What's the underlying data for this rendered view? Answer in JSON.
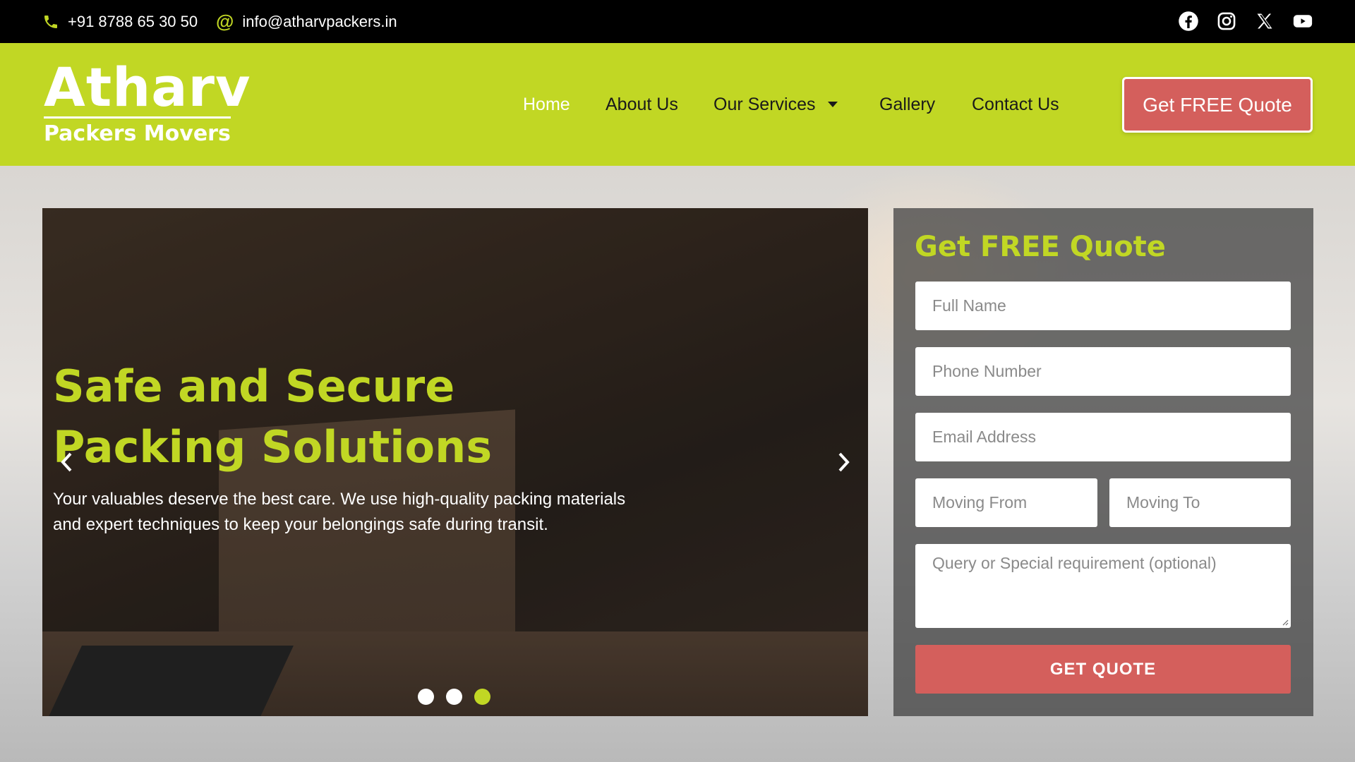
{
  "topbar": {
    "phone": "+91 8788 65 30 50",
    "email": "info@atharvpackers.in",
    "socials": [
      "facebook-icon",
      "instagram-icon",
      "x-icon",
      "youtube-icon"
    ]
  },
  "header": {
    "logo_main": "Atharv",
    "logo_sub": "Packers Movers",
    "nav": [
      {
        "label": "Home",
        "active": true
      },
      {
        "label": "About Us"
      },
      {
        "label": "Our Services",
        "has_dropdown": true
      },
      {
        "label": "Gallery"
      },
      {
        "label": "Contact Us"
      }
    ],
    "cta": "Get FREE Quote"
  },
  "hero": {
    "title_line1": "Safe and Secure",
    "title_line2": "Packing Solutions",
    "description": "Your valuables deserve the best care. We use high-quality packing materials and expert techniques to keep your belongings safe during transit.",
    "slides_count": 3,
    "active_slide": 3
  },
  "form": {
    "title": "Get FREE Quote",
    "full_name_placeholder": "Full Name",
    "phone_placeholder": "Phone Number",
    "email_placeholder": "Email Address",
    "from_placeholder": "Moving From",
    "to_placeholder": "Moving To",
    "query_placeholder": "Query or Special requirement (optional)",
    "submit_label": "GET QUOTE"
  },
  "colors": {
    "accent": "#c1d724",
    "cta": "#d45f5c",
    "topbar": "#000000"
  }
}
